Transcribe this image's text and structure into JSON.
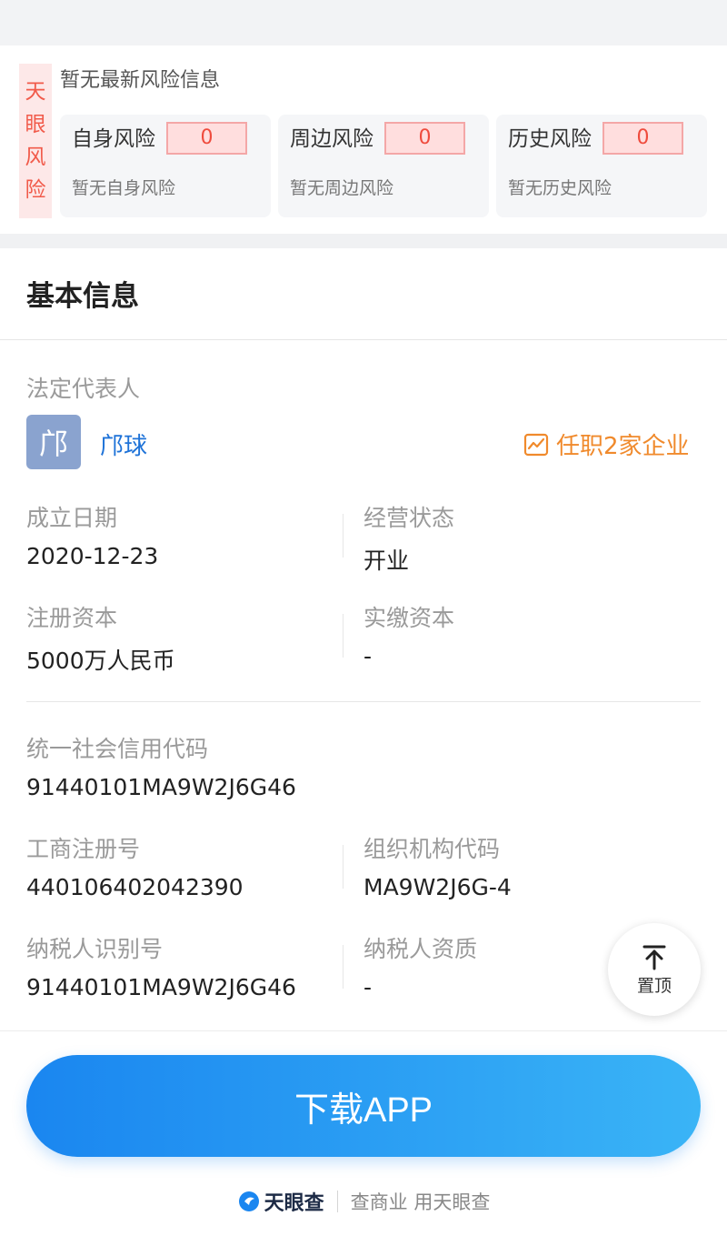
{
  "risk": {
    "tag_chars": [
      "天",
      "眼",
      "风",
      "险"
    ],
    "title": "暂无最新风险信息",
    "cards": [
      {
        "name": "自身风险",
        "count": "0",
        "sub": "暂无自身风险"
      },
      {
        "name": "周边风险",
        "count": "0",
        "sub": "暂无周边风险"
      },
      {
        "name": "历史风险",
        "count": "0",
        "sub": "暂无历史风险"
      }
    ]
  },
  "basic": {
    "title": "基本信息",
    "legal_rep_label": "法定代表人",
    "legal_rep_avatar": "邝",
    "legal_rep_name": "邝球",
    "positions_text": "任职2家企业",
    "fields": {
      "est_date_label": "成立日期",
      "est_date": "2020-12-23",
      "status_label": "经营状态",
      "status": "开业",
      "reg_capital_label": "注册资本",
      "reg_capital": "5000万人民币",
      "paid_capital_label": "实缴资本",
      "paid_capital": "-",
      "credit_code_label": "统一社会信用代码",
      "credit_code": "91440101MA9W2J6G46",
      "biz_reg_no_label": "工商注册号",
      "biz_reg_no": "440106402042390",
      "org_code_label": "组织机构代码",
      "org_code": "MA9W2J6G-4",
      "taxpayer_id_label": "纳税人识别号",
      "taxpayer_id": "91440101MA9W2J6G46",
      "taxpayer_qual_label": "纳税人资质",
      "taxpayer_qual": "-"
    }
  },
  "to_top_label": "置顶",
  "download_label": "下载APP",
  "footer": {
    "brand": "天眼查",
    "slogan": "查商业 用天眼查"
  },
  "colors": {
    "risk_red": "#ef4b3d",
    "link_blue": "#1f73d8",
    "orange": "#f08a2c",
    "button_gradient_start": "#1a86f0",
    "button_gradient_end": "#3ab4f6"
  }
}
